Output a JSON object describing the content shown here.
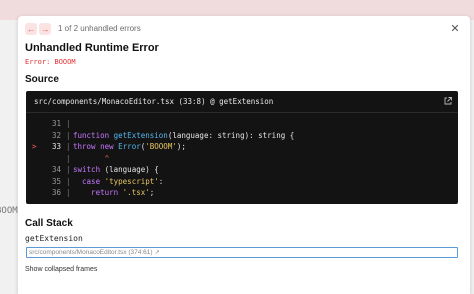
{
  "backdrop": {
    "left_fragment": "BOOM"
  },
  "header": {
    "prev_glyph": "←",
    "next_glyph": "→",
    "error_count": "1 of 2 unhandled errors",
    "close_glyph": "✕"
  },
  "error": {
    "title": "Unhandled Runtime Error",
    "message": "Error: BOOOM"
  },
  "source": {
    "heading": "Source",
    "file_ref": "src/components/MonacoEditor.tsx (33:8) @ getExtension",
    "lines": [
      {
        "num": "31",
        "marker": "",
        "bar": "|",
        "tokens": []
      },
      {
        "num": "32",
        "marker": "",
        "bar": "|",
        "tokens": [
          {
            "t": "function ",
            "c": "kw"
          },
          {
            "t": "getExtension",
            "c": "fn"
          },
          {
            "t": "(language: string): string {",
            "c": ""
          }
        ]
      },
      {
        "num": "33",
        "marker": ">",
        "bar": "|",
        "tokens": [
          {
            "t": "throw ",
            "c": "kw"
          },
          {
            "t": "new ",
            "c": "kw"
          },
          {
            "t": "Error",
            "c": "fn"
          },
          {
            "t": "(",
            "c": ""
          },
          {
            "t": "'BOOOM'",
            "c": "str"
          },
          {
            "t": ");",
            "c": ""
          }
        ]
      },
      {
        "num": "",
        "marker": "",
        "bar": "|",
        "tokens": [
          {
            "t": "       ^",
            "c": "caret"
          }
        ]
      },
      {
        "num": "34",
        "marker": "",
        "bar": "|",
        "tokens": [
          {
            "t": "switch ",
            "c": "kw"
          },
          {
            "t": "(language) {",
            "c": ""
          }
        ]
      },
      {
        "num": "35",
        "marker": "",
        "bar": "|",
        "tokens": [
          {
            "t": "  case ",
            "c": "kw"
          },
          {
            "t": "'typescript'",
            "c": "str"
          },
          {
            "t": ":",
            "c": ""
          }
        ]
      },
      {
        "num": "36",
        "marker": "",
        "bar": "|",
        "tokens": [
          {
            "t": "    return ",
            "c": "kw"
          },
          {
            "t": "'.tsx'",
            "c": "str"
          },
          {
            "t": ";",
            "c": ""
          }
        ]
      }
    ]
  },
  "call_stack": {
    "heading": "Call Stack",
    "frame_name": "getExtension",
    "frame_file": "src/components/MonacoEditor.tsx (374:61)",
    "frame_ext_glyph": "↗",
    "show_collapsed": "Show collapsed frames"
  }
}
